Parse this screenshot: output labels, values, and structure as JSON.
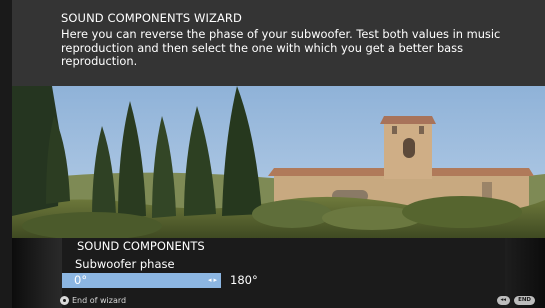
{
  "wizard": {
    "title": "SOUND COMPONENTS WIZARD",
    "text": "Here you can reverse the phase of your subwoofer. Test both values in music reproduction and then select the one with which you get a better bass reproduction."
  },
  "menu": {
    "title": "SOUND COMPONENTS",
    "subtitle": "Subwoofer phase",
    "options": {
      "selected": "0°",
      "other": "180°"
    },
    "arrow_icons": [
      "left-arrow-icon",
      "right-arrow-icon"
    ]
  },
  "footer": {
    "end_label": "End of wizard",
    "keys": [
      "◂◂",
      "END"
    ]
  },
  "colors": {
    "info_panel": "#343434",
    "menu_background": "#1b1b1b",
    "selected_highlight": "#8cb6e2"
  }
}
